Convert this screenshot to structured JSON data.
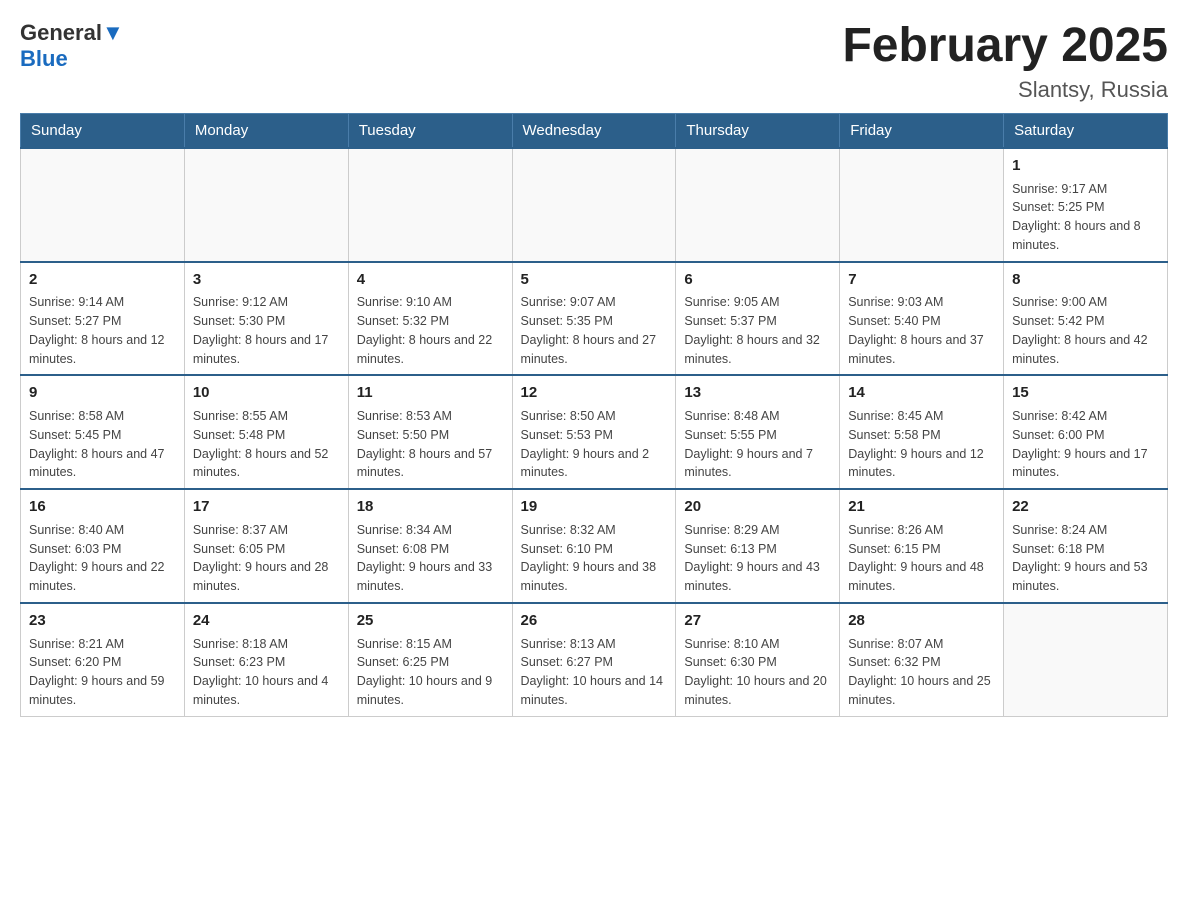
{
  "logo": {
    "text_general": "General",
    "text_blue": "Blue"
  },
  "title": "February 2025",
  "location": "Slantsy, Russia",
  "weekdays": [
    "Sunday",
    "Monday",
    "Tuesday",
    "Wednesday",
    "Thursday",
    "Friday",
    "Saturday"
  ],
  "weeks": [
    [
      {
        "day": "",
        "info": ""
      },
      {
        "day": "",
        "info": ""
      },
      {
        "day": "",
        "info": ""
      },
      {
        "day": "",
        "info": ""
      },
      {
        "day": "",
        "info": ""
      },
      {
        "day": "",
        "info": ""
      },
      {
        "day": "1",
        "info": "Sunrise: 9:17 AM\nSunset: 5:25 PM\nDaylight: 8 hours and 8 minutes."
      }
    ],
    [
      {
        "day": "2",
        "info": "Sunrise: 9:14 AM\nSunset: 5:27 PM\nDaylight: 8 hours and 12 minutes."
      },
      {
        "day": "3",
        "info": "Sunrise: 9:12 AM\nSunset: 5:30 PM\nDaylight: 8 hours and 17 minutes."
      },
      {
        "day": "4",
        "info": "Sunrise: 9:10 AM\nSunset: 5:32 PM\nDaylight: 8 hours and 22 minutes."
      },
      {
        "day": "5",
        "info": "Sunrise: 9:07 AM\nSunset: 5:35 PM\nDaylight: 8 hours and 27 minutes."
      },
      {
        "day": "6",
        "info": "Sunrise: 9:05 AM\nSunset: 5:37 PM\nDaylight: 8 hours and 32 minutes."
      },
      {
        "day": "7",
        "info": "Sunrise: 9:03 AM\nSunset: 5:40 PM\nDaylight: 8 hours and 37 minutes."
      },
      {
        "day": "8",
        "info": "Sunrise: 9:00 AM\nSunset: 5:42 PM\nDaylight: 8 hours and 42 minutes."
      }
    ],
    [
      {
        "day": "9",
        "info": "Sunrise: 8:58 AM\nSunset: 5:45 PM\nDaylight: 8 hours and 47 minutes."
      },
      {
        "day": "10",
        "info": "Sunrise: 8:55 AM\nSunset: 5:48 PM\nDaylight: 8 hours and 52 minutes."
      },
      {
        "day": "11",
        "info": "Sunrise: 8:53 AM\nSunset: 5:50 PM\nDaylight: 8 hours and 57 minutes."
      },
      {
        "day": "12",
        "info": "Sunrise: 8:50 AM\nSunset: 5:53 PM\nDaylight: 9 hours and 2 minutes."
      },
      {
        "day": "13",
        "info": "Sunrise: 8:48 AM\nSunset: 5:55 PM\nDaylight: 9 hours and 7 minutes."
      },
      {
        "day": "14",
        "info": "Sunrise: 8:45 AM\nSunset: 5:58 PM\nDaylight: 9 hours and 12 minutes."
      },
      {
        "day": "15",
        "info": "Sunrise: 8:42 AM\nSunset: 6:00 PM\nDaylight: 9 hours and 17 minutes."
      }
    ],
    [
      {
        "day": "16",
        "info": "Sunrise: 8:40 AM\nSunset: 6:03 PM\nDaylight: 9 hours and 22 minutes."
      },
      {
        "day": "17",
        "info": "Sunrise: 8:37 AM\nSunset: 6:05 PM\nDaylight: 9 hours and 28 minutes."
      },
      {
        "day": "18",
        "info": "Sunrise: 8:34 AM\nSunset: 6:08 PM\nDaylight: 9 hours and 33 minutes."
      },
      {
        "day": "19",
        "info": "Sunrise: 8:32 AM\nSunset: 6:10 PM\nDaylight: 9 hours and 38 minutes."
      },
      {
        "day": "20",
        "info": "Sunrise: 8:29 AM\nSunset: 6:13 PM\nDaylight: 9 hours and 43 minutes."
      },
      {
        "day": "21",
        "info": "Sunrise: 8:26 AM\nSunset: 6:15 PM\nDaylight: 9 hours and 48 minutes."
      },
      {
        "day": "22",
        "info": "Sunrise: 8:24 AM\nSunset: 6:18 PM\nDaylight: 9 hours and 53 minutes."
      }
    ],
    [
      {
        "day": "23",
        "info": "Sunrise: 8:21 AM\nSunset: 6:20 PM\nDaylight: 9 hours and 59 minutes."
      },
      {
        "day": "24",
        "info": "Sunrise: 8:18 AM\nSunset: 6:23 PM\nDaylight: 10 hours and 4 minutes."
      },
      {
        "day": "25",
        "info": "Sunrise: 8:15 AM\nSunset: 6:25 PM\nDaylight: 10 hours and 9 minutes."
      },
      {
        "day": "26",
        "info": "Sunrise: 8:13 AM\nSunset: 6:27 PM\nDaylight: 10 hours and 14 minutes."
      },
      {
        "day": "27",
        "info": "Sunrise: 8:10 AM\nSunset: 6:30 PM\nDaylight: 10 hours and 20 minutes."
      },
      {
        "day": "28",
        "info": "Sunrise: 8:07 AM\nSunset: 6:32 PM\nDaylight: 10 hours and 25 minutes."
      },
      {
        "day": "",
        "info": ""
      }
    ]
  ]
}
